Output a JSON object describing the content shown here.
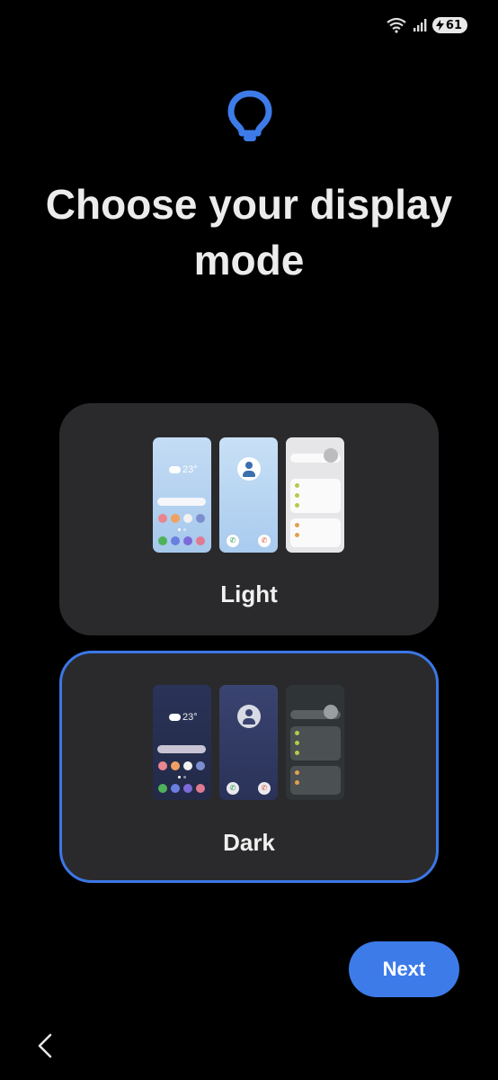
{
  "status_bar": {
    "battery_level": "61",
    "icons": [
      "wifi-icon",
      "signal-icon",
      "charging-icon"
    ]
  },
  "page": {
    "title": "Choose your display mode"
  },
  "options": [
    {
      "label": "Light",
      "selected": false,
      "preview_temperature": "23°"
    },
    {
      "label": "Dark",
      "selected": true,
      "preview_temperature": "23°"
    }
  ],
  "actions": {
    "next_label": "Next"
  },
  "colors": {
    "accent": "#3d7be9",
    "card_bg": "#2a2a2c",
    "background": "#000000"
  }
}
